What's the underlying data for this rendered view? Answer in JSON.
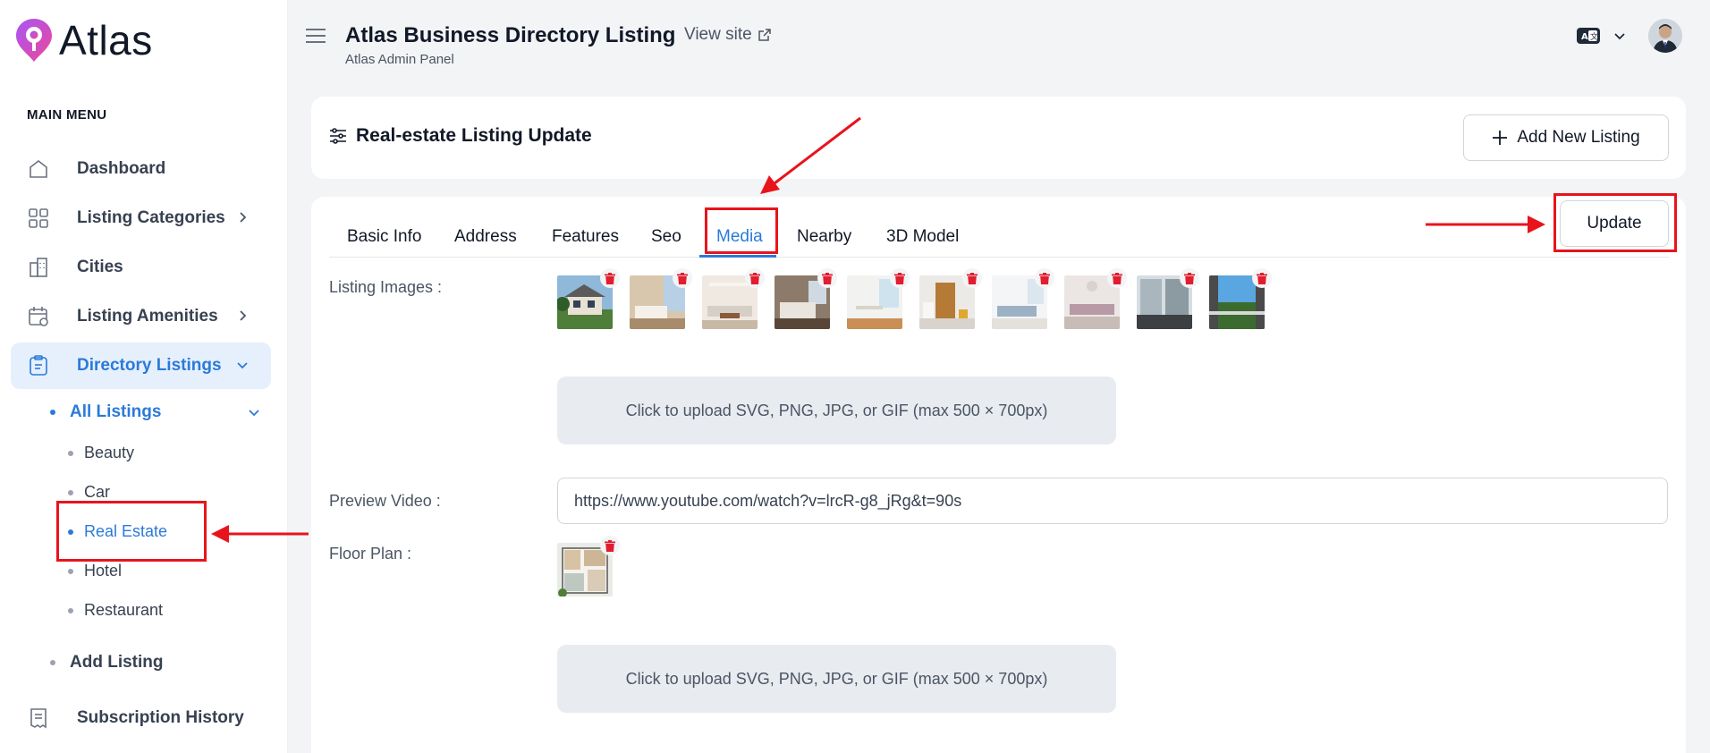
{
  "app": {
    "logo_text": "Atlas",
    "title": "Atlas Business Directory Listing",
    "subtitle": "Atlas Admin Panel",
    "view_site": "View site"
  },
  "sidebar": {
    "heading": "MAIN MENU",
    "items": [
      {
        "label": "Dashboard",
        "icon": "home-icon"
      },
      {
        "label": "Listing Categories",
        "icon": "grid-icon",
        "has_chevron": true
      },
      {
        "label": "Cities",
        "icon": "building-icon"
      },
      {
        "label": "Listing Amenities",
        "icon": "calendar-icon",
        "has_chevron": true
      },
      {
        "label": "Directory Listings",
        "icon": "clipboard-icon",
        "active": true,
        "expanded": true
      },
      {
        "label": "Subscription History",
        "icon": "receipt-icon"
      }
    ],
    "sub_items": {
      "all_listings": "All Listings",
      "categories": [
        "Beauty",
        "Car",
        "Real Estate",
        "Hotel",
        "Restaurant"
      ],
      "add_listing": "Add Listing"
    },
    "active_sub": "Real Estate"
  },
  "page": {
    "card_title": "Real-estate Listing Update",
    "add_new_label": "Add New Listing",
    "update_label": "Update",
    "tabs": [
      "Basic Info",
      "Address",
      "Features",
      "Seo",
      "Media",
      "Nearby",
      "3D Model"
    ],
    "active_tab": "Media"
  },
  "media": {
    "listing_images_label": "Listing Images :",
    "image_count": 10,
    "upload_hint": "Click to upload SVG, PNG, JPG, or GIF (max 500 × 700px)",
    "preview_video_label": "Preview Video :",
    "preview_video_value": "https://www.youtube.com/watch?v=lrcR-g8_jRg&t=90s",
    "floor_plan_label": "Floor Plan :",
    "floor_upload_hint": "Click to upload SVG, PNG, JPG, or GIF (max 500 × 700px)"
  },
  "colors": {
    "accent": "#2b7ad9",
    "annotation_red": "#e8141c",
    "delete_red": "#e11d2e"
  }
}
